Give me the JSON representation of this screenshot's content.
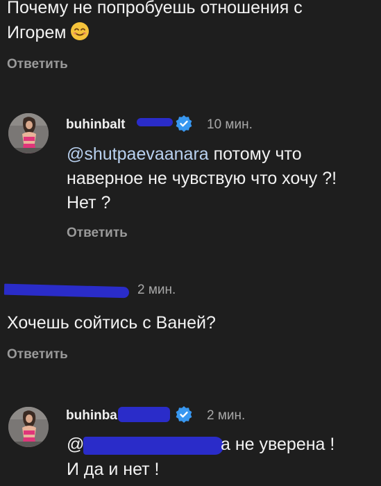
{
  "comments": [
    {
      "text_line1": "Почему не попробуешь отношения с",
      "text_line2": "Игорем",
      "emoji": "smiling-face-icon",
      "reply_label": "Ответить"
    },
    {
      "username": "buhinbalt",
      "verified": true,
      "time": "10 мин.",
      "mention": "@shutpaevaanara",
      "text_line1": " потому что",
      "text_line2": "наверное не чувствую что хочу ?!",
      "text_line3": "Нет ?",
      "reply_label": "Ответить"
    },
    {
      "time": "2 мин.",
      "text_line1": "Хочешь сойтись с Ваней?",
      "reply_label": "Ответить"
    },
    {
      "username": "buhinba",
      "verified": true,
      "time": "2 мин.",
      "mention": "@",
      "text_line1": "а не уверена !",
      "text_line2": "И да и нет !"
    }
  ],
  "colors": {
    "background": "#1e1e1e",
    "redaction": "#2a2cc9",
    "verified_badge": "#3897f0"
  }
}
